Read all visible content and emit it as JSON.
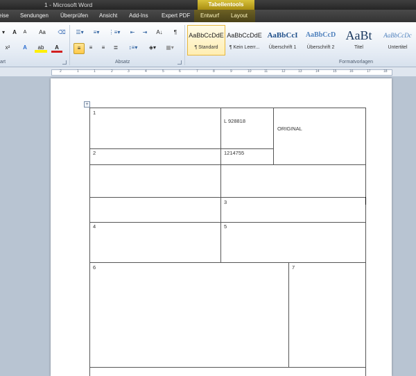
{
  "window": {
    "title": "1 - Microsoft Word",
    "contextual_header": "Tabellentools"
  },
  "tabs": [
    {
      "label": "eise"
    },
    {
      "label": "Sendungen"
    },
    {
      "label": "Überprüfen"
    },
    {
      "label": "Ansicht"
    },
    {
      "label": "Add-Ins"
    },
    {
      "label": "Expert PDF"
    },
    {
      "label": "Entwurf"
    },
    {
      "label": "Layout"
    }
  ],
  "ribbon": {
    "groups": {
      "font_partial": "tart",
      "paragraph": "Absatz",
      "styles": "Formatvorlagen"
    },
    "font_buttons": {
      "grow": "A",
      "shrink": "A",
      "case": "Aa",
      "superscript": "x²",
      "effects": "A",
      "highlight": "ab",
      "color": "A"
    },
    "paragraph_buttons": {
      "pilcrow": "¶",
      "sort": "A↓"
    },
    "styles": [
      {
        "preview": "AaBbCcDdE",
        "name": "¶ Standard",
        "active": true
      },
      {
        "preview": "AaBbCcDdE",
        "name": "¶ Kein Leerr...",
        "active": false
      },
      {
        "preview": "AaBbCcI",
        "name": "Überschrift 1",
        "active": false
      },
      {
        "preview": "AaBbCcD",
        "name": "Überschrift 2",
        "active": false
      },
      {
        "preview": "AaBt",
        "name": "Titel",
        "active": false
      },
      {
        "preview": "AaBbCcDc",
        "name": "Untertitel",
        "active": false
      }
    ]
  },
  "ruler": {
    "labels": [
      "2",
      "1",
      "1",
      "2",
      "3",
      "4",
      "5",
      "6",
      "7",
      "8",
      "9",
      "10",
      "11",
      "12",
      "13",
      "14",
      "15",
      "16",
      "17",
      "18"
    ]
  },
  "document": {
    "cells": {
      "c1": "1",
      "l_number": "L 928818",
      "original": "ORIGINAL",
      "c2": "2",
      "number_2": "1214755",
      "c3": "3",
      "c4": "4",
      "c5": "5",
      "c6": "6",
      "c7": "7"
    }
  }
}
